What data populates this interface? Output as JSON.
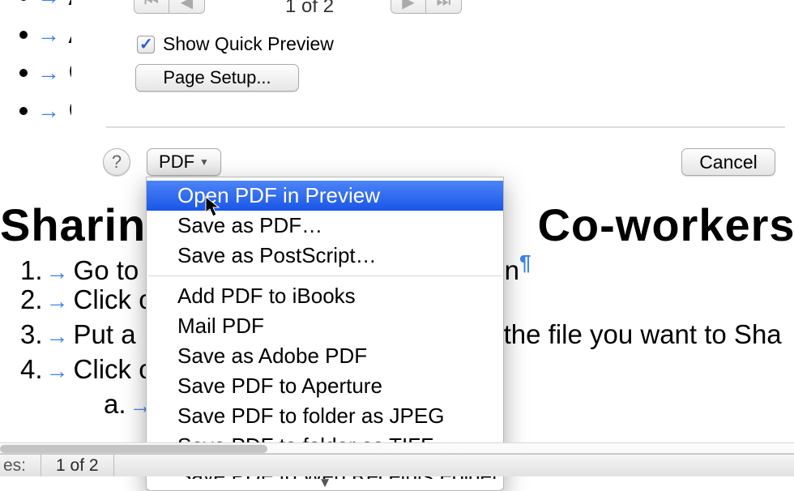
{
  "doc": {
    "bullets": [
      "A",
      "A",
      "C",
      "C"
    ],
    "heading_left": "Sharing",
    "heading_right": "Co-workers an",
    "list": {
      "1": "Go to",
      "1_tail": "in",
      "2": "Click on",
      "3": "Put a",
      "3_tail": "the file you want to Sha",
      "4": "Click on",
      "a": "a."
    }
  },
  "dialog": {
    "pager": "1 of 2",
    "show_quick_preview": "Show Quick Preview",
    "page_setup": "Page Setup...",
    "help": "?",
    "pdf_label": "PDF",
    "cancel": "Cancel"
  },
  "menu": {
    "items": [
      "Open PDF in Preview",
      "Save as PDF…",
      "Save as PostScript…"
    ],
    "items2": [
      "Add PDF to iBooks",
      "Mail PDF",
      "Save as Adobe PDF",
      "Save PDF to Aperture",
      "Save PDF to folder as JPEG",
      "Save PDF to folder as TIFF",
      "Save PDF to Web Receipts Folder"
    ]
  },
  "status": {
    "left": "es:",
    "pages": "1 of 2"
  }
}
